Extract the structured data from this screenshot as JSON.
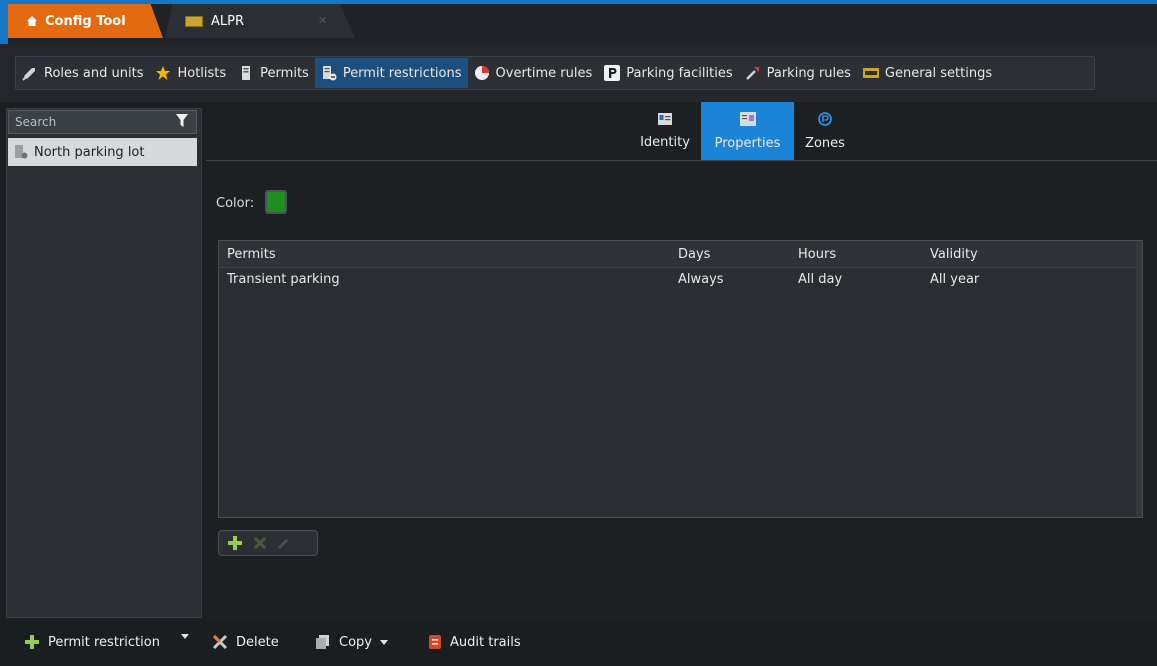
{
  "titlebar": {
    "tabs": [
      {
        "label": "Config Tool",
        "icon": "home-icon"
      },
      {
        "label": "ALPR",
        "icon": "alpr-icon"
      }
    ],
    "close_glyph": "✕"
  },
  "modules": [
    {
      "label": "Roles and units",
      "icon": "roles-units-icon",
      "active": false
    },
    {
      "label": "Hotlists",
      "icon": "hotlist-star-icon",
      "active": false
    },
    {
      "label": "Permits",
      "icon": "permits-icon",
      "active": false
    },
    {
      "label": "Permit restrictions",
      "icon": "permit-restriction-icon",
      "active": true
    },
    {
      "label": "Overtime rules",
      "icon": "overtime-icon",
      "active": false
    },
    {
      "label": "Parking facilities",
      "icon": "parking-p-icon",
      "active": false
    },
    {
      "label": "Parking rules",
      "icon": "parking-rules-icon",
      "active": false
    },
    {
      "label": "General settings",
      "icon": "general-settings-icon",
      "active": false
    }
  ],
  "sidebar": {
    "search_placeholder": "Search",
    "items": [
      {
        "label": "North parking lot"
      }
    ]
  },
  "subtabs": [
    {
      "label": "Identity",
      "icon": "identity-card-icon"
    },
    {
      "label": "Properties",
      "icon": "properties-icon",
      "active": true
    },
    {
      "label": "Zones",
      "icon": "zones-icon"
    }
  ],
  "properties": {
    "color_label": "Color:",
    "color_value": "#1f8c1f"
  },
  "table": {
    "columns": [
      "Permits",
      "Days",
      "Hours",
      "Validity"
    ],
    "rows": [
      [
        "Transient parking",
        "Always",
        "All day",
        "All year"
      ]
    ]
  },
  "bottom": {
    "add_label": "Permit restriction",
    "delete_label": "Delete",
    "copy_label": "Copy",
    "audit_label": "Audit trails"
  },
  "colors": {
    "accent_blue": "#1b84d6",
    "config_orange": "#e46a10"
  }
}
